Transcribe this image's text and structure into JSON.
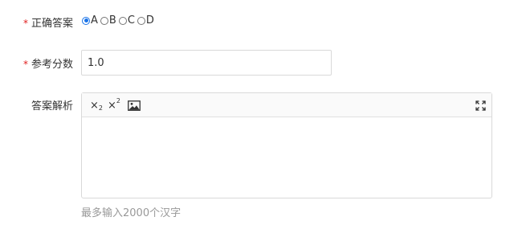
{
  "form": {
    "answer": {
      "label": "正确答案",
      "required_mark": "*",
      "options": [
        {
          "label": "A",
          "checked": true
        },
        {
          "label": "B",
          "checked": false
        },
        {
          "label": "C",
          "checked": false
        },
        {
          "label": "D",
          "checked": false
        }
      ]
    },
    "score": {
      "label": "参考分数",
      "required_mark": "*",
      "value": "1.0"
    },
    "analysis": {
      "label": "答案解析",
      "toolbar": {
        "subscript_icon": "subscript-icon",
        "superscript_icon": "superscript-icon",
        "image_icon": "image-icon",
        "fullscreen_icon": "fullscreen-icon"
      },
      "hint": "最多输入2000个汉字"
    }
  },
  "colors": {
    "required": "#e02020",
    "accent": "#1a73e8",
    "border": "#d9d9d9",
    "hint_text": "#999999"
  }
}
